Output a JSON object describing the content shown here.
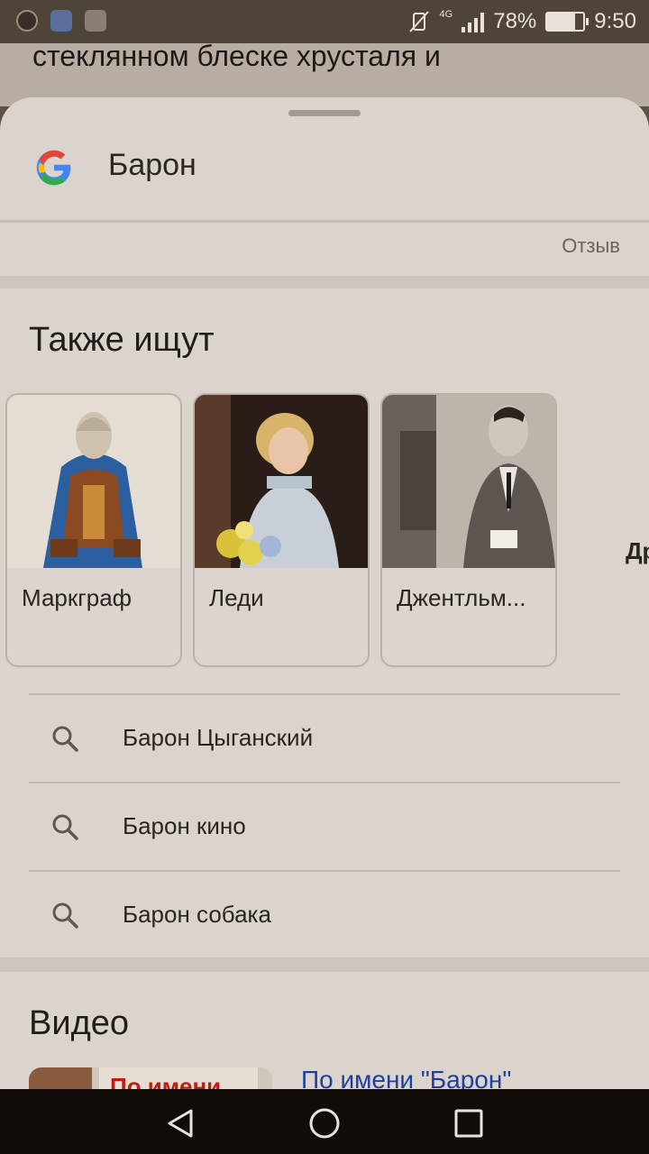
{
  "status_bar": {
    "network": "4G",
    "battery": "78%",
    "battery_fraction": 0.78,
    "time": "9:50"
  },
  "background_text": "стеклянном блеске хрусталя и",
  "search": {
    "query": "Барон",
    "feedback": "Отзыв"
  },
  "also_searched": {
    "title": "Также ищут",
    "cards": [
      {
        "label": "Маркграф",
        "image": "armored-warrior-illustration"
      },
      {
        "label": "Леди",
        "image": "woman-with-flowers-photo"
      },
      {
        "label": "Джентльм...",
        "image": "man-in-suit-photo"
      }
    ],
    "partial_next": "Др"
  },
  "related_searches": [
    {
      "text": "Барон Цыганский",
      "icon": "search-icon"
    },
    {
      "text": "Барон кино",
      "icon": "search-icon"
    },
    {
      "text": "Барон собака",
      "icon": "search-icon"
    }
  ],
  "video": {
    "title": "Видео",
    "thumb_text": "По имени",
    "link": "По имени \"Барон\""
  },
  "nav": {
    "back": "back-icon",
    "home": "home-icon",
    "recents": "recents-icon"
  }
}
